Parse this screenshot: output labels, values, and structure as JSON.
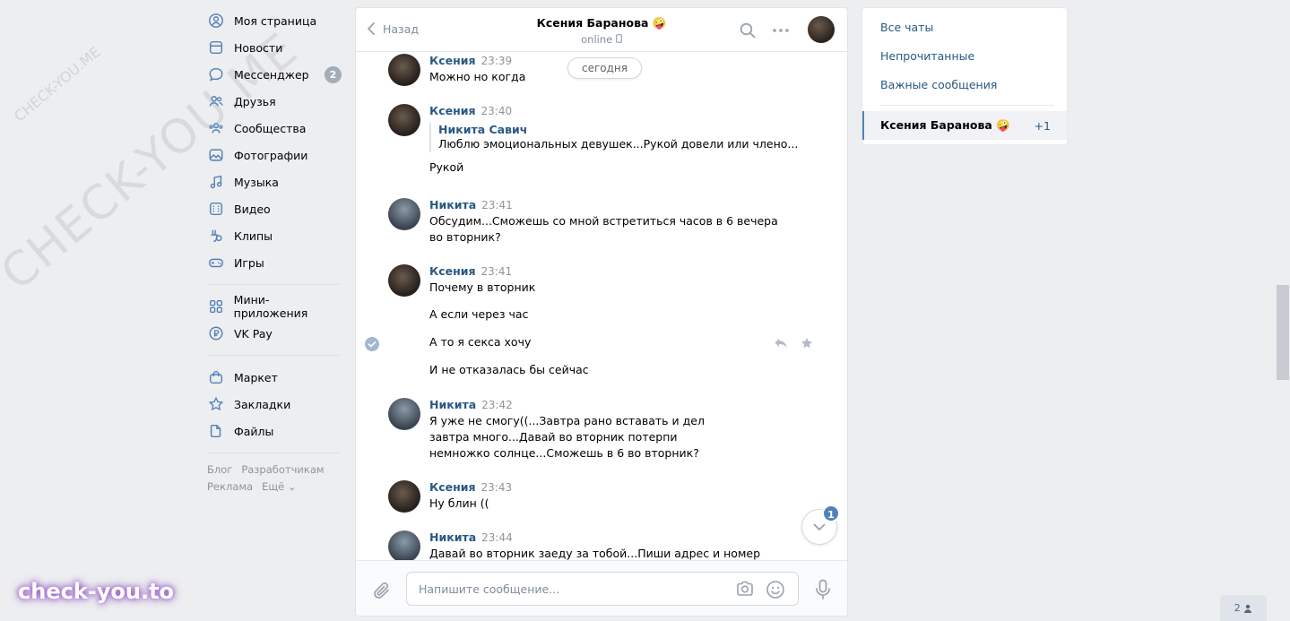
{
  "watermark": {
    "diagonal_text": "CHECK-YOU.ME",
    "logo_text": "check-you.to"
  },
  "nav": {
    "items": [
      {
        "label": "Моя страница",
        "icon": "user-circle-icon"
      },
      {
        "label": "Новости",
        "icon": "news-icon"
      },
      {
        "label": "Мессенджер",
        "icon": "chat-bubble-icon",
        "badge": "2"
      },
      {
        "label": "Друзья",
        "icon": "friends-icon"
      },
      {
        "label": "Сообщества",
        "icon": "groups-icon"
      },
      {
        "label": "Фотографии",
        "icon": "photo-icon"
      },
      {
        "label": "Музыка",
        "icon": "music-icon"
      },
      {
        "label": "Видео",
        "icon": "video-icon"
      },
      {
        "label": "Клипы",
        "icon": "clips-icon"
      },
      {
        "label": "Игры",
        "icon": "gamepad-icon"
      }
    ],
    "items2": [
      {
        "label": "Мини-приложения",
        "icon": "apps-icon"
      },
      {
        "label": "VK Pay",
        "icon": "vkpay-icon"
      }
    ],
    "items3": [
      {
        "label": "Маркет",
        "icon": "market-icon"
      },
      {
        "label": "Закладки",
        "icon": "bookmark-icon"
      },
      {
        "label": "Файлы",
        "icon": "file-icon"
      }
    ],
    "footer": {
      "blog": "Блог",
      "dev": "Разработчикам",
      "ads": "Реклама",
      "more": "Ещё ⌄"
    }
  },
  "chat": {
    "back_label": "Назад",
    "peer_name": "Ксения Баранова 🤪",
    "peer_status": "online",
    "date_pill": "сегодня",
    "messages": [
      {
        "author": "Ксения",
        "time": "23:39",
        "text": "Можно но когда"
      },
      {
        "author": "Ксения",
        "time": "23:40",
        "quote_author": "Никита Савич",
        "quote_text": "Люблю эмоциональных девушек...Рукой довели или члено...",
        "text": "Рукой"
      },
      {
        "author": "Никита",
        "time": "23:41",
        "text": "Обсудим...Сможешь со мной встретиться часов в 6 вечера во вторник?"
      },
      {
        "author": "Ксения",
        "time": "23:41",
        "text": "Почему в вторник",
        "extra": [
          "А если через час",
          "А то я секса хочу",
          "И не отказалась бы сейчас"
        ]
      },
      {
        "author": "Никита",
        "time": "23:42",
        "text": "Я уже не смогу((...Завтра рано вставать и дел завтра много...Давай во вторник потерпи немножко солнце...Сможешь в 6 во вторник?"
      },
      {
        "author": "Ксения",
        "time": "23:43",
        "text": "Ну блин (("
      },
      {
        "author": "Никита",
        "time": "23:44",
        "text": "Давай во вторник заеду за тобой...Пиши адрес и номер"
      }
    ],
    "unread_badge": "1",
    "composer_placeholder": "Напишите сообщение..."
  },
  "folders": {
    "all": "Все чаты",
    "unread": "Непрочитанные",
    "important": "Важные сообщения",
    "active_chat": {
      "name": "Ксения Баранова 🤪",
      "count": "+1"
    }
  },
  "online_count": "2"
}
